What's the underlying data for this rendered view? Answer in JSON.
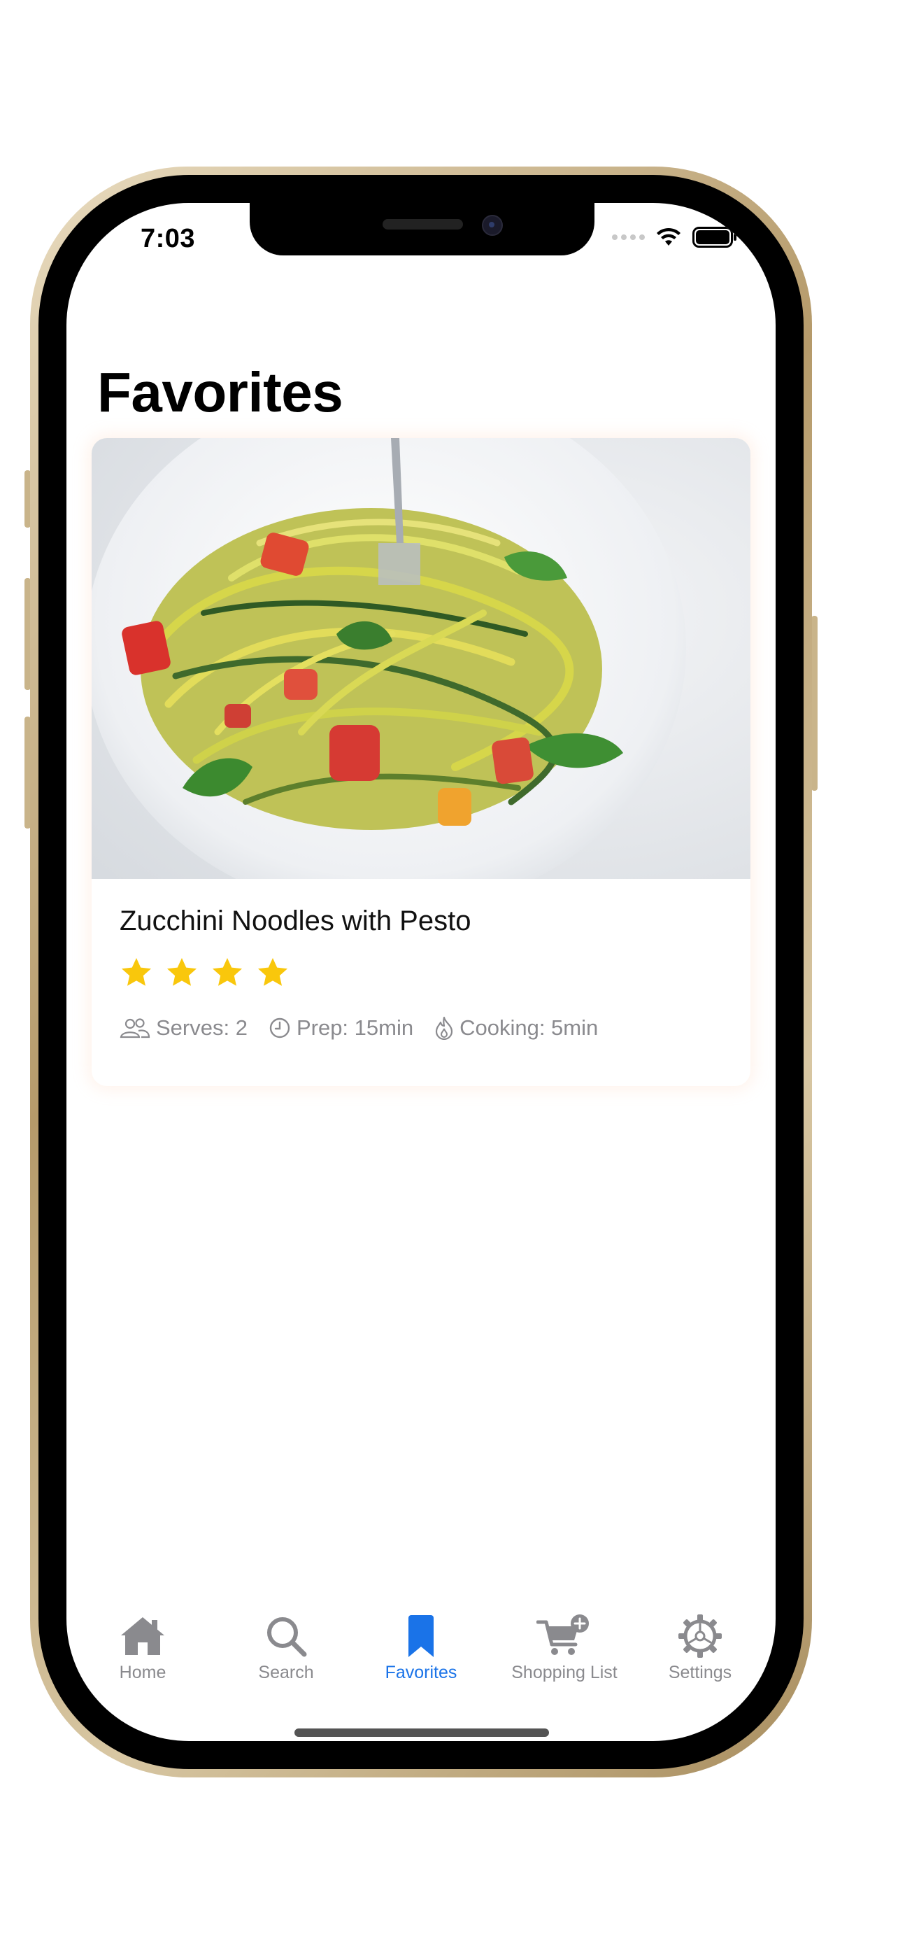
{
  "status_bar": {
    "time": "7:03"
  },
  "page": {
    "title": "Favorites"
  },
  "favorites": [
    {
      "title": "Zucchini Noodles with Pesto",
      "rating": 4,
      "serves": "Serves: 2",
      "prep": "Prep: 15min",
      "cooking": "Cooking: 5min"
    }
  ],
  "tab_bar": {
    "items": [
      {
        "label": "Home",
        "icon": "house-icon"
      },
      {
        "label": "Search",
        "icon": "magnifier-icon"
      },
      {
        "label": "Favorites",
        "icon": "bookmark-icon",
        "active": true
      },
      {
        "label": "Shopping List",
        "icon": "cart-plus-icon"
      },
      {
        "label": "Settings",
        "icon": "gear-icon"
      }
    ]
  },
  "colors": {
    "accent": "#1a73e8",
    "star": "#f9c70c",
    "inactive": "#8a8a8e"
  }
}
